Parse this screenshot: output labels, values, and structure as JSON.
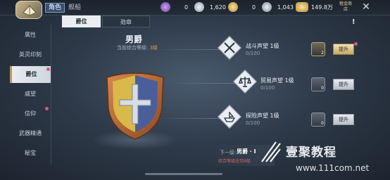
{
  "topbar": {
    "avatar_icon": "ship-emblem-icon",
    "tab_role": "角色",
    "tab_ship": "舰船",
    "resources": [
      {
        "icon": "purple-gem-icon",
        "value": "0"
      },
      {
        "icon": "silver-gem-icon",
        "value": "1,620"
      },
      {
        "icon": "gold-coin-icon",
        "value": "0"
      },
      {
        "icon": "silver-coin-icon",
        "value": "1,043"
      },
      {
        "icon": "gold-ingot-icon",
        "value": "149.8万"
      }
    ],
    "shop_label": "租金商店",
    "close_icon": "close-icon"
  },
  "sidebar": {
    "items": [
      {
        "label": "属性"
      },
      {
        "label": "英灵印刻"
      },
      {
        "label": "爵位"
      },
      {
        "label": "威望"
      },
      {
        "label": "信仰"
      },
      {
        "label": "武器精通"
      },
      {
        "label": "秘宝"
      }
    ]
  },
  "tabs": {
    "rank": "爵位",
    "badge": "勋章"
  },
  "info_mark": "!",
  "rank": {
    "title": "男爵",
    "level_label": "当前综合等级:",
    "level_value": "3级"
  },
  "reputations": [
    {
      "name": "战斗声望 1级",
      "progress": "0/100",
      "icon": "crossed-swords-icon",
      "item_count": "2",
      "button": "提升"
    },
    {
      "name": "贸易声望 1级",
      "progress": "0/100",
      "icon": "scales-icon",
      "item_count": "0",
      "button": "提升"
    },
    {
      "name": "探险声望 1级",
      "progress": "0/100",
      "icon": "ship-icon",
      "item_count": "0",
      "button": "提升"
    }
  ],
  "next": {
    "label": "下一级:",
    "value": "男爵 · I",
    "requirement": "综合等级达到4级"
  },
  "watermark": {
    "text": "壹聚教程",
    "url": "www.111com.net"
  }
}
